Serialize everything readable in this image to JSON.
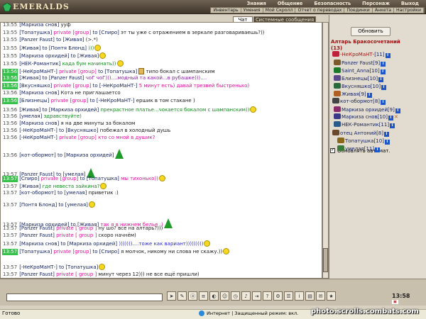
{
  "app": {
    "logo": "EMERALDS"
  },
  "main_menu": [
    "Знания",
    "Общение",
    "Безопасность",
    "Персонаж",
    "Выход"
  ],
  "sub_menu": [
    "Инвентарь",
    "Умения",
    "Мой Скролл",
    "Отчет о переводах",
    "Поединки",
    "Анкета",
    "Настройки"
  ],
  "tabs": {
    "chat": "Чат",
    "system": "Системные сообщения"
  },
  "chat": [
    {
      "time": "13:55",
      "hl": false,
      "nick": "[Маркиза снов]",
      "rest": " ууф",
      "rest_color": "plain"
    },
    {
      "time": "13:55",
      "hl": false,
      "nick": "[Топатушка]",
      "priv": " private [group]",
      "to": " to [Спиро]",
      "rest": " эт ты уже с отражением в зеркале разговариваешь?))",
      "rest_color": "plain"
    },
    {
      "time": "13:55",
      "hl": false,
      "nick": "[Panzer Faust]",
      "to": " to [Живая]",
      "rest": " (>.*)",
      "rest_color": "plain"
    },
    {
      "time": "13:55",
      "hl": false,
      "nick": "[Живая]",
      "to": " to [Понтя Блонд]",
      "rest": " )))",
      "rest_color": "green"
    },
    {
      "time": "13:55",
      "hl": false,
      "nick": "[Маркиза орхидей]",
      "to": " to [Живая]",
      "rest": "",
      "rest_color": "plain"
    },
    {
      "time": "13:55",
      "hl": false,
      "nick": "[НЕК-Романтик]",
      "rest": " када бум начинать))",
      "rest_color": "green"
    },
    {
      "time": "13:56",
      "hl": true,
      "nick": "[-НеКроМаНТ-]",
      "priv": " private [group]",
      "to": " to [Топатушка]",
      "rest": " типо бокал с шампанским",
      "rest_color": "plain"
    },
    {
      "time": "13:56",
      "hl": true,
      "nick": "[Живая]",
      "to": " to [Panzer Faust]",
      "rest": " чоГ чоГ)))....модный та какой...в рубашке)))....",
      "rest_color": "purple"
    },
    {
      "time": "13:56",
      "hl": true,
      "nick": "[Вкусняшко]",
      "priv": " private [group]",
      "to": " to [-НеКроМаНТ-]",
      "rest": " 5 минут есть) давай трезвей быстренько)",
      "rest_color": "pink"
    },
    {
      "time": "13:56",
      "hl": false,
      "nick": "[Маркиза снов]",
      "rest": " Кота не приглашаетсо",
      "rest_color": "plain"
    },
    {
      "time": "13:56",
      "hl": true,
      "nick": "[Близнецы]",
      "priv": " private [group]",
      "to": " to [-НеКроМаНТ-]",
      "rest": " ершик в том стакане )",
      "rest_color": "plain"
    },
    {
      "time": "13:56",
      "hl": false,
      "nick": "[Живая]",
      "to": " to [Маркиза орхидей]",
      "rest": " прекрастное платье...чокается бокалом с шампанским))",
      "rest_color": "green"
    },
    {
      "time": "13:56",
      "hl": false,
      "nick": "[умелая]",
      "rest": " здравствуйте)",
      "rest_color": "green"
    },
    {
      "time": "13:56",
      "hl": false,
      "nick": "[Маркиза снов]",
      "rest": " я на две минуты за бокалом",
      "rest_color": "plain"
    },
    {
      "time": "13:56",
      "hl": false,
      "nick": "[-НеКроМаНТ-]",
      "to": " to [Вкусняшко]",
      "rest": " побежал в холодный душь",
      "rest_color": "plain"
    },
    {
      "time": "13:56",
      "hl": false,
      "nick": "[-НеКроМаНТ-]",
      "priv": " private [group]",
      "rest": " кто со мной в душик?",
      "rest_color": "pink"
    },
    {
      "time": "13:56",
      "hl": false,
      "nick": "[кот-обормот]",
      "to": " to [Маркиза орхидей]",
      "rest": "",
      "rest_color": "plain"
    },
    {
      "time": "13:57",
      "hl": false,
      "nick": "[Panzer Faust]",
      "to": " to [умелая]",
      "rest": "",
      "rest_color": "plain"
    },
    {
      "time": "13:57",
      "hl": true,
      "nick": "[Спиро]",
      "priv": " private [group]",
      "to": " to [Топатушка]",
      "rest": " мы тихонько))",
      "rest_color": "pink"
    },
    {
      "time": "13:57",
      "hl": false,
      "nick": "[Живая]",
      "rest": " где невеста зайкина?",
      "rest_color": "green"
    },
    {
      "time": "13:57",
      "hl": false,
      "nick": "[кот-обормот]",
      "to": " to [умелая]",
      "rest": " приветик :)",
      "rest_color": "plain"
    },
    {
      "time": "13:57",
      "hl": false,
      "nick": "[Понтя Блонд]",
      "to": " to [умелая]",
      "rest": "",
      "rest_color": "plain"
    },
    {
      "time": "13:57",
      "hl": false,
      "nick": "[Маркиза орхидей]",
      "to": " to [Живая]",
      "rest": " так я в нижнем белье :)",
      "rest_color": "pink"
    },
    {
      "time": "13:57",
      "hl": false,
      "nick": "[Panzer Faust]",
      "priv": " private [ group ]",
      "rest": " ну шо? все на алтарь?)))",
      "rest_color": "plain"
    },
    {
      "time": "13:57",
      "hl": false,
      "nick": "[Panzer Faust]",
      "priv": " private [ group ]",
      "rest": " скоро начнём)",
      "rest_color": "plain"
    },
    {
      "time": "13:57",
      "hl": false,
      "nick": "[Маркиза снов]",
      "to": " to [Маркиза орхидей]",
      "rest": " )))))))....тоже как вариант)))))))))",
      "rest_color": "blue"
    },
    {
      "time": "13:57",
      "hl": true,
      "nick": "[Топатушка]",
      "priv": " private [group]",
      "to": " to [Спиро]",
      "rest": " я молчок, никому ни слова не скажу.))",
      "rest_color": "plain"
    },
    {
      "time": "13:57",
      "hl": false,
      "nick": "[-НеКроМаНТ-]",
      "to": " to [Топатушка]",
      "rest": "",
      "rest_color": "plain"
    },
    {
      "time": "13:57",
      "hl": false,
      "nick": "[Panzer Faust]",
      "priv": " private [ group ]",
      "rest": " минут через 12))) не все ещё пришли)",
      "rest_color": "plain"
    }
  ],
  "sidebar": {
    "refresh": "Обновить",
    "room": "Алтарь Бракосочетаний (13)",
    "users": [
      {
        "name": "-НеКроМаНТ-",
        "level": "[11]",
        "color": "#c0203a"
      },
      {
        "name": "Panzer Faust",
        "level": "[9]",
        "color": "#7a5a2a"
      },
      {
        "name": "Saint_Anna",
        "level": "[10]",
        "color": "#1a7a2a"
      },
      {
        "name": "Близнецы",
        "level": "[10]",
        "color": "#5a4a8a"
      },
      {
        "name": "Вкусняшко",
        "level": "[10]",
        "color": "#2a6a3a"
      },
      {
        "name": "Живая",
        "level": "[9]",
        "color": "#b06020"
      },
      {
        "name": "кот-обормот",
        "level": "[8]",
        "color": "#444"
      },
      {
        "name": "Маркиза орхидей",
        "level": "[9]",
        "color": "#8a2a6a"
      },
      {
        "name": "Маркиза снов",
        "level": "[10]",
        "color": "#3a3a8a"
      },
      {
        "name": "НЕК-Романтик",
        "level": "[11]",
        "color": "#2a5a8a"
      },
      {
        "name": "отец Антоний",
        "level": "[8]",
        "color": "#6a4a2a"
      },
      {
        "name": "Топатушка",
        "level": "[10]",
        "color": "#8a6a1a"
      },
      {
        "name": "умелая",
        "level": "[11]",
        "color": "#3a7a3a"
      }
    ],
    "auto_update": "Обновлять автомат."
  },
  "clock": "13:58",
  "status": {
    "ready": "Готово",
    "zone": "Интернет | Защищенный режим: вкл."
  },
  "watermark": "photo.scrolls.combats.com"
}
